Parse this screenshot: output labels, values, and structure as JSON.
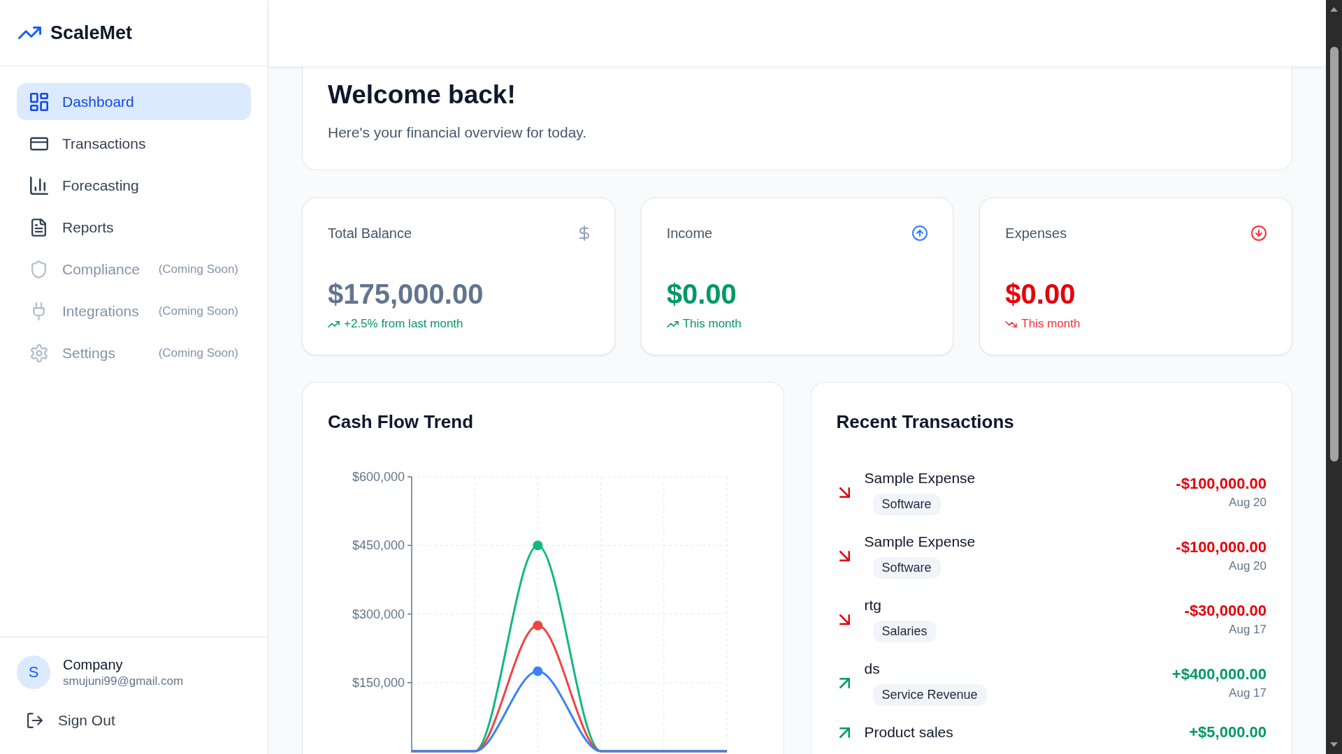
{
  "sidebar": {
    "logo": "ScaleMet",
    "nav_items": [
      {
        "label": "Dashboard",
        "selected": true,
        "disabled": false
      },
      {
        "label": "Transactions",
        "selected": false,
        "disabled": false
      },
      {
        "label": "Forecasting",
        "selected": false,
        "disabled": false
      },
      {
        "label": "Reports",
        "selected": false,
        "disabled": false
      },
      {
        "label": "Compliance",
        "note": "(Coming Soon)",
        "selected": false,
        "disabled": true
      },
      {
        "label": "Integrations",
        "note": "(Coming Soon)",
        "selected": false,
        "disabled": true
      },
      {
        "label": "Settings",
        "note": "(Coming Soon)",
        "selected": false,
        "disabled": true
      }
    ],
    "user": {
      "avatar_initial": "S",
      "name": "Company",
      "email": "smujuni99@gmail.com"
    },
    "sign_out": "Sign Out"
  },
  "welcome": {
    "title": "Welcome back!",
    "subtitle": "Here's your financial overview for today."
  },
  "stats": [
    {
      "kind": "balance",
      "label": "Total Balance",
      "value": "$175,000.00",
      "note": "+2.5% from last month"
    },
    {
      "kind": "income",
      "label": "Income",
      "value": "$0.00",
      "note": "This month"
    },
    {
      "kind": "expenses",
      "label": "Expenses",
      "value": "$0.00",
      "note": "This month"
    }
  ],
  "cash_flow": {
    "title": "Cash Flow Trend",
    "chart_data": {
      "type": "line",
      "grid": true,
      "categories": [
        null,
        null,
        null,
        null,
        null,
        null
      ],
      "series": [
        {
          "color": "#10b981",
          "values": [
            0,
            0,
            450000,
            0,
            0,
            0
          ]
        },
        {
          "color": "#ef4444",
          "values": [
            0,
            0,
            275000,
            0,
            0,
            0
          ]
        },
        {
          "color": "#3b82f6",
          "values": [
            0,
            0,
            175000,
            0,
            0,
            0
          ]
        }
      ],
      "ylim": [
        0,
        600000
      ],
      "yticks": [
        {
          "value": 150000,
          "label": "$150,000"
        },
        {
          "value": 300000,
          "label": "$300,000"
        },
        {
          "value": 450000,
          "label": "$450,000"
        },
        {
          "value": 600000,
          "label": "$600,000"
        }
      ]
    }
  },
  "recent_transactions": {
    "title": "Recent Transactions",
    "rows": [
      {
        "kind": "expense",
        "name": "Sample Expense",
        "category": "Software",
        "amount": "-$100,000.00",
        "date": "Aug 20"
      },
      {
        "kind": "expense",
        "name": "Sample Expense",
        "category": "Software",
        "amount": "-$100,000.00",
        "date": "Aug 20"
      },
      {
        "kind": "expense",
        "name": "rtg",
        "category": "Salaries",
        "amount": "-$30,000.00",
        "date": "Aug 17"
      },
      {
        "kind": "income",
        "name": "ds",
        "category": "Service Revenue",
        "amount": "+$400,000.00",
        "date": "Aug 17"
      },
      {
        "kind": "income",
        "name": "Product sales",
        "amount": "+$5,000.00"
      }
    ]
  }
}
